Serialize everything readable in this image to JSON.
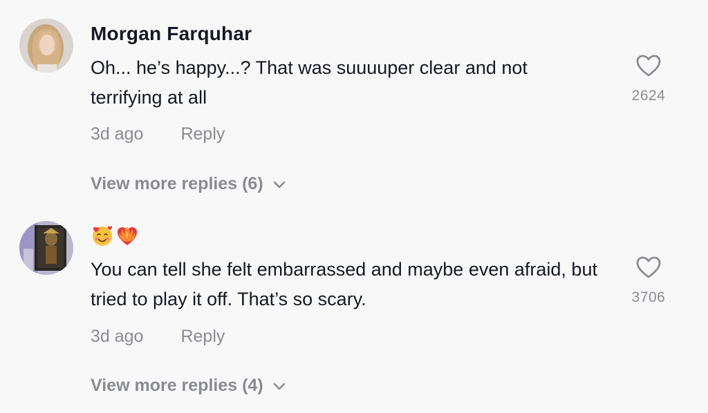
{
  "comments": [
    {
      "username": "Morgan Farquhar",
      "text": "Oh... he’s happy...? That was suuuuper clear and not terrifying at all",
      "time": "3d ago",
      "reply_label": "Reply",
      "likes": "2624",
      "view_more": "View more replies (6)",
      "avatar_icon": "user-photo-avatar"
    },
    {
      "username": "🥰❤️‍🔥",
      "text": "You can tell she felt embarrassed and maybe even afraid, but tried to play it off. That’s so scary.",
      "time": "3d ago",
      "reply_label": "Reply",
      "likes": "3706",
      "view_more": "View more replies (4)",
      "avatar_icon": "user-photo-avatar"
    }
  ],
  "icons": {
    "like": "heart-outline-icon",
    "expand": "chevron-down-icon"
  },
  "colors": {
    "background": "#f8f8f8",
    "primary_text": "#161823",
    "secondary_text": "#8a8b91"
  }
}
